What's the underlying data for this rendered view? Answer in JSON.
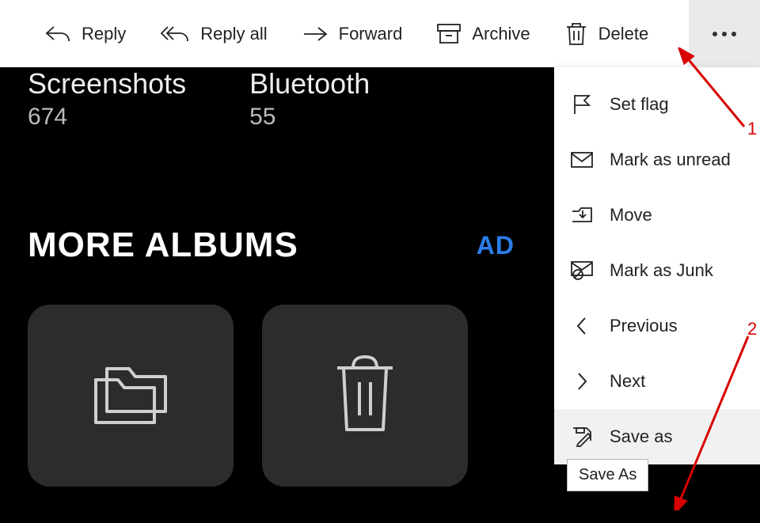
{
  "toolbar": {
    "reply": "Reply",
    "reply_all": "Reply all",
    "forward": "Forward",
    "archive": "Archive",
    "delete": "Delete"
  },
  "content": {
    "album1_title": "Screenshots",
    "album1_count": "674",
    "album2_title": "Bluetooth",
    "album2_count": "55",
    "more_albums": "MORE ALBUMS",
    "add": "AD"
  },
  "menu": {
    "set_flag": "Set flag",
    "mark_unread": "Mark as unread",
    "move": "Move",
    "mark_junk": "Mark as Junk",
    "previous": "Previous",
    "next": "Next",
    "save_as": "Save as"
  },
  "tooltip": "Save As",
  "anno": {
    "one": "1",
    "two": "2"
  }
}
